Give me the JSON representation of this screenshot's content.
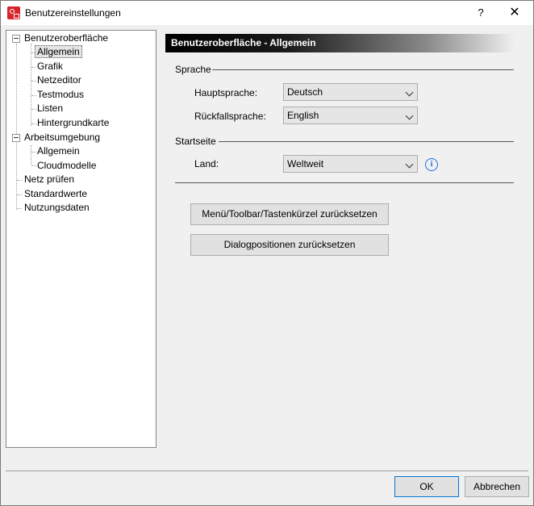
{
  "window": {
    "title": "Benutzereinstellungen",
    "help": "?",
    "close": "✕"
  },
  "tree": {
    "items": [
      {
        "label": "Benutzeroberfläche"
      },
      {
        "label": "Allgemein"
      },
      {
        "label": "Grafik"
      },
      {
        "label": "Netzeditor"
      },
      {
        "label": "Testmodus"
      },
      {
        "label": "Listen"
      },
      {
        "label": "Hintergrundkarte"
      },
      {
        "label": "Arbeitsumgebung"
      },
      {
        "label": "Allgemein"
      },
      {
        "label": "Cloudmodelle"
      },
      {
        "label": "Netz prüfen"
      },
      {
        "label": "Standardwerte"
      },
      {
        "label": "Nutzungsdaten"
      }
    ]
  },
  "panel": {
    "header": "Benutzeroberfläche - Allgemein",
    "sprache": {
      "label": "Sprache",
      "haupt_label": "Hauptsprache:",
      "haupt_value": "Deutsch",
      "rueck_label": "Rückfallsprache:",
      "rueck_value": "English"
    },
    "startseite": {
      "label": "Startseite",
      "land_label": "Land:",
      "land_value": "Weltweit",
      "info": "i"
    },
    "reset_menu": "Menü/Toolbar/Tastenkürzel zurücksetzen",
    "reset_dialog": "Dialogpositionen zurücksetzen"
  },
  "footer": {
    "ok": "OK",
    "cancel": "Abbrechen"
  },
  "colors": {
    "accent": "#0078d7",
    "info": "#1a73e8",
    "app_icon": "#d6262d"
  }
}
